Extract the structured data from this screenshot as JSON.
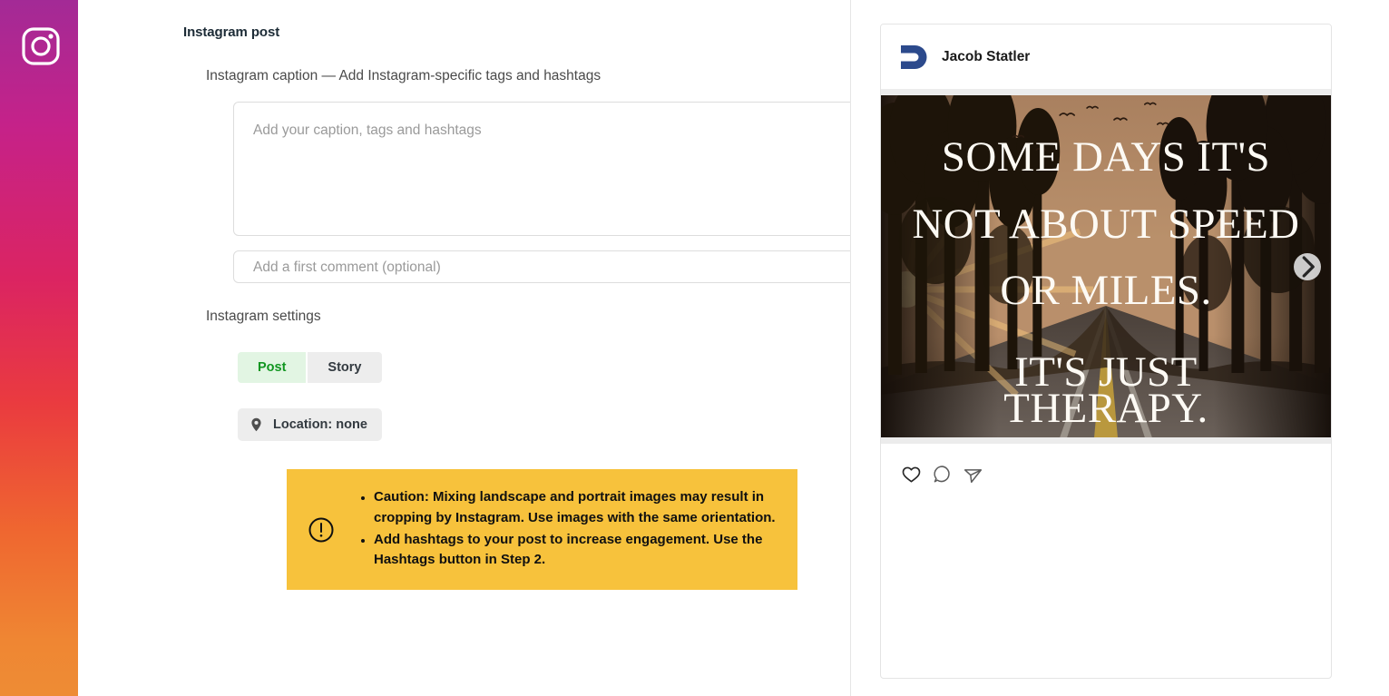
{
  "rail": {
    "icon": "instagram-logo-icon",
    "gradient_top": "#a32a96",
    "gradient_mid": "#ea3b3f",
    "gradient_bottom": "#ee8c34"
  },
  "composer": {
    "panel_title": "Instagram post",
    "caption_label": "Instagram caption — Add Instagram-specific tags and hashtags",
    "caption": {
      "value": "",
      "placeholder": "Add your caption, tags and hashtags",
      "emoji_icon": "smiley-face-icon"
    },
    "first_comment": {
      "value": "",
      "placeholder": "Add a first comment (optional)",
      "emoji_icon": "smiley-face-icon"
    },
    "settings_label": "Instagram settings",
    "post_type": {
      "options": [
        "Post",
        "Story"
      ],
      "selected": "Post",
      "selected_bg": "#e2f5e3",
      "selected_color": "#119621",
      "unselected_bg": "#ededed",
      "unselected_color": "#333a40"
    },
    "location": {
      "label": "Location: none",
      "icon": "map-pin-icon",
      "bg": "#ededed"
    },
    "warning": {
      "bg": "#f7c23c",
      "icon": "exclamation-circle-icon",
      "items": [
        "Caution: Mixing landscape and portrait images may result in cropping by Instagram. Use images with the same orientation.",
        "Add hashtags to your post to increase engagement. Use the Hashtags button in Step 2."
      ]
    }
  },
  "preview": {
    "account_name": "Jacob Statler",
    "avatar_icon": "brand-monogram-avatar",
    "avatar_color": "#2c4a8c",
    "media": {
      "alt": "forest road at sunset with quote overlay",
      "quote_lines": [
        "SOME DAYS IT'S",
        "NOT ABOUT SPEED",
        "OR MILES.",
        "IT'S JUST",
        "THERAPY."
      ],
      "sky_color": "#b08868",
      "carousel_next_icon": "chevron-right-icon"
    },
    "actions": [
      {
        "icon": "heart-icon",
        "name": "like"
      },
      {
        "icon": "comment-bubble-icon",
        "name": "comment"
      },
      {
        "icon": "paper-plane-icon",
        "name": "share"
      }
    ]
  }
}
